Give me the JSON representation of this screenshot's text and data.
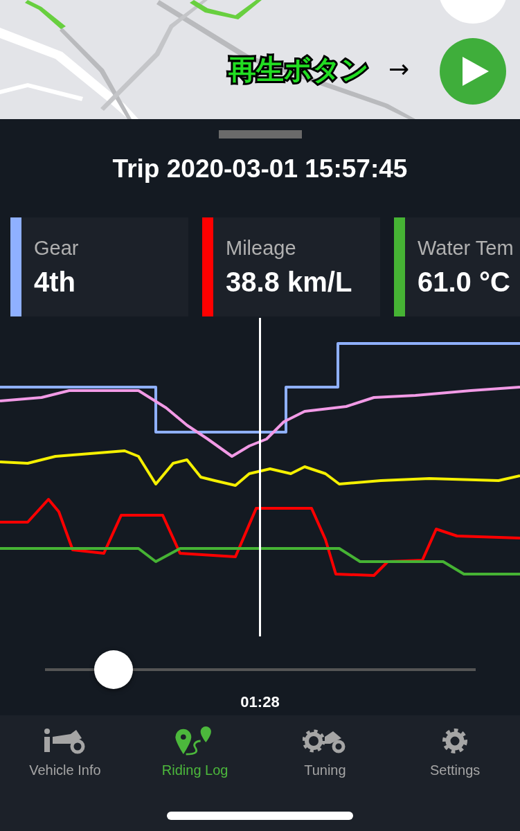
{
  "map": {
    "annotation": "再生ボタン",
    "arrow": "→"
  },
  "trip": {
    "title": "Trip 2020-03-01 15:57:45"
  },
  "cards": [
    {
      "label": "Gear",
      "value": "4th",
      "color": "#8fb0ff"
    },
    {
      "label": "Mileage",
      "value": "38.8 km/L",
      "color": "#ff0000"
    },
    {
      "label": "Water Tem",
      "value": "61.0 °C",
      "color": "#46b334"
    }
  ],
  "playback": {
    "level": 0.16,
    "time": "01:28"
  },
  "tabs": [
    {
      "label": "Vehicle Info",
      "selected": false,
      "kind": "vehicle"
    },
    {
      "label": "Riding Log",
      "selected": true,
      "kind": "log"
    },
    {
      "label": "Tuning",
      "selected": false,
      "kind": "tuning"
    },
    {
      "label": "Settings",
      "selected": false,
      "kind": "settings"
    }
  ]
}
